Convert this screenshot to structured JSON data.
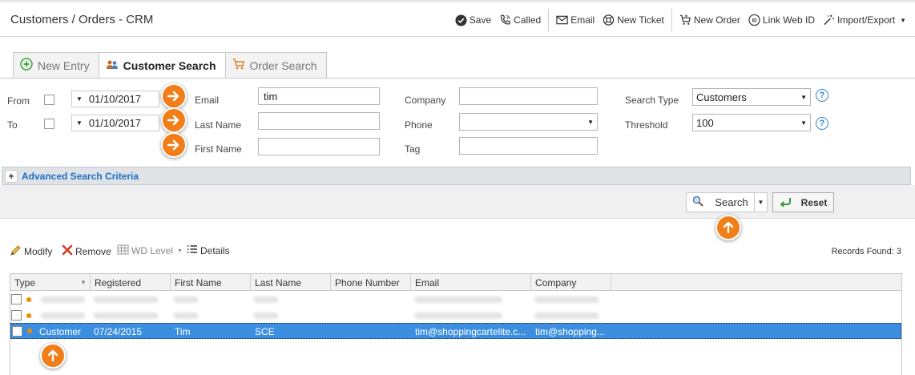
{
  "header": {
    "title": "Customers / Orders - CRM",
    "toolbar": [
      {
        "label": "Save",
        "icon": "checkmark-circle-icon"
      },
      {
        "label": "Called",
        "icon": "phone-icon"
      },
      {
        "label": "Email",
        "icon": "envelope-icon"
      },
      {
        "label": "New Ticket",
        "icon": "lifebuoy-icon"
      },
      {
        "label": "New Order",
        "icon": "cart-icon"
      },
      {
        "label": "Link Web ID",
        "icon": "id-badge-icon"
      },
      {
        "label": "Import/Export",
        "icon": "magic-wand-icon"
      }
    ]
  },
  "tabs": [
    {
      "label": "New Entry",
      "icon": "plus-circle-icon"
    },
    {
      "label": "Customer Search",
      "icon": "users-icon"
    },
    {
      "label": "Order Search",
      "icon": "cart-icon"
    }
  ],
  "search": {
    "from_label": "From",
    "to_label": "To",
    "from_date": "01/10/2017",
    "to_date": "01/10/2017",
    "email_label": "Email",
    "email_value": "tim",
    "lastname_label": "Last Name",
    "lastname_value": "",
    "firstname_label": "First Name",
    "firstname_value": "",
    "company_label": "Company",
    "company_value": "",
    "phone_label": "Phone",
    "phone_value": "",
    "tag_label": "Tag",
    "tag_value": "",
    "search_type_label": "Search Type",
    "search_type_value": "Customers",
    "threshold_label": "Threshold",
    "threshold_value": "100",
    "help_glyph": "?"
  },
  "advanced": {
    "toggle": "+",
    "label": "Advanced Search Criteria"
  },
  "actions": {
    "search_label": "Search",
    "reset_label": "Reset"
  },
  "grid_toolbar": {
    "modify": "Modify",
    "remove": "Remove",
    "wd_level": "WD Level",
    "details": "Details",
    "records_found": "Records Found: 3"
  },
  "grid": {
    "columns": [
      "Type",
      "Registered",
      "First Name",
      "Last Name",
      "Phone Number",
      "Email",
      "Company"
    ],
    "selected_row": {
      "type": "Customer",
      "registered": "07/24/2015",
      "first_name": "Tim",
      "last_name": "SCE",
      "phone": "",
      "email": "tim@shoppingcartelite.c...",
      "company": "tim@shopping..."
    }
  },
  "colors": {
    "accent_orange": "#f07f1a",
    "link_blue": "#1a6fc1",
    "selection_blue": "#3c8fe0"
  }
}
